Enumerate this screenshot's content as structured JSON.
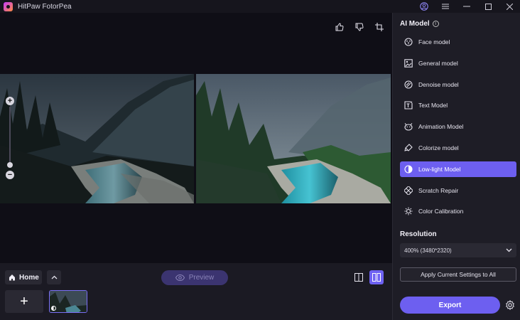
{
  "app": {
    "title": "HitPaw FotorPea"
  },
  "panel": {
    "heading": "AI Model",
    "models": [
      {
        "label": "Face model",
        "icon": "face-icon",
        "active": false
      },
      {
        "label": "General model",
        "icon": "image-icon",
        "active": false
      },
      {
        "label": "Denoise model",
        "icon": "denoise-icon",
        "active": false
      },
      {
        "label": "Text Model",
        "icon": "text-icon",
        "active": false
      },
      {
        "label": "Animation Model",
        "icon": "animation-icon",
        "active": false
      },
      {
        "label": "Colorize model",
        "icon": "colorize-icon",
        "active": false
      },
      {
        "label": "Low-light Model",
        "icon": "low-light-icon",
        "active": true
      },
      {
        "label": "Scratch Repair",
        "icon": "scratch-icon",
        "active": false
      },
      {
        "label": "Color Calibration",
        "icon": "calibration-icon",
        "active": false
      }
    ],
    "resolution_heading": "Resolution",
    "resolution_value": "400% (3480*2320)",
    "apply_label": "Apply Current Settings to All",
    "export_label": "Export"
  },
  "bottom": {
    "home_label": "Home",
    "preview_label": "Preview",
    "add_label": "+"
  },
  "colors": {
    "accent": "#6d5ff0",
    "background": "#0f0e16",
    "panel": "#1e1d26"
  }
}
